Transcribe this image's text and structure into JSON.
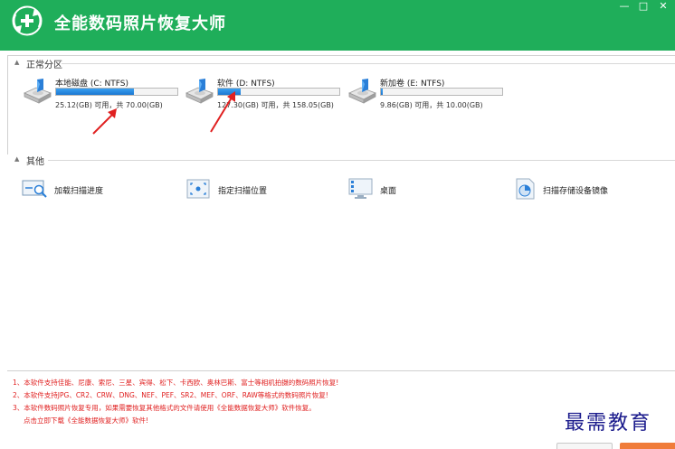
{
  "app": {
    "title": "全能数码照片恢复大师"
  },
  "window": {
    "minimize": "—",
    "maximize": "□",
    "close": "✕"
  },
  "sections": {
    "normal_partition": "正常分区",
    "other": "其他"
  },
  "drives": [
    {
      "name": "本地磁盘 (C: NTFS)",
      "info": "25.12(GB) 可用，共 70.00(GB)",
      "used_fraction": 0.64
    },
    {
      "name": "软件 (D: NTFS)",
      "info": "127.30(GB) 可用，共 158.05(GB)",
      "used_fraction": 0.19
    },
    {
      "name": "新加卷 (E: NTFS)",
      "info": "9.86(GB) 可用，共 10.00(GB)",
      "used_fraction": 0.014
    }
  ],
  "tools": [
    {
      "label": "加载扫描进度",
      "icon": "search-progress-icon"
    },
    {
      "label": "指定扫描位置",
      "icon": "scan-location-icon"
    },
    {
      "label": "桌面",
      "icon": "desktop-icon"
    },
    {
      "label": "扫描存储设备镜像",
      "icon": "disk-image-icon"
    }
  ],
  "notes": [
    "1、本软件支持佳能、尼康、索尼、三星、宾得、松下、卡西欧、奥林巴斯、富士等相机拍摄的数码照片恢复!",
    "2、本软件支持JPG、CR2、CRW、DNG、NEF、PEF、SR2、MEF、ORF、RAW等格式的数码照片恢复!",
    "3、本软件数码照片恢复专用，如果需要恢复其他格式的文件请使用《全能数据恢复大师》软件恢复。",
    "点击立即下载《全能数据恢复大师》软件!"
  ],
  "watermark": "最需教育",
  "colors": {
    "title_bar": "#1fae5a",
    "progress": "#1c78d2",
    "note": "#e02020",
    "annotation_arrow": "#e02020"
  }
}
